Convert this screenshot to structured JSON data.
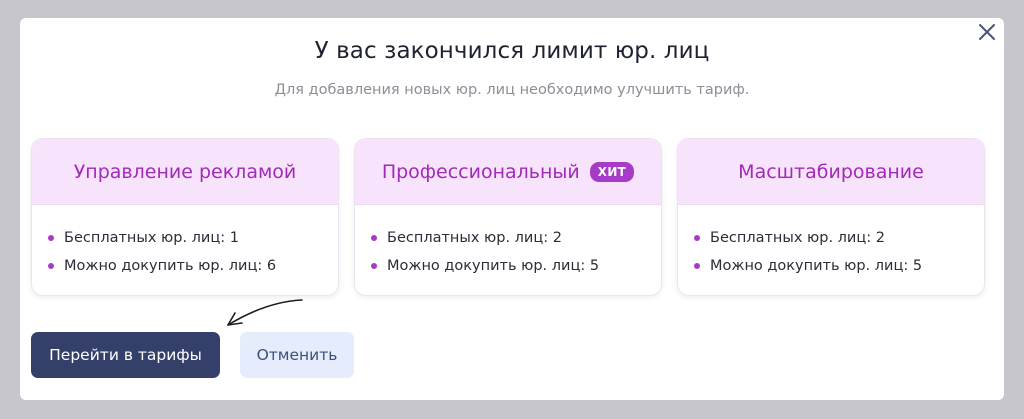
{
  "modal": {
    "title": "У вас закончился лимит юр. лиц",
    "subtitle": "Для добавления новых юр. лиц необходимо улучшить тариф.",
    "close_icon": "close-icon"
  },
  "plans": [
    {
      "name": "Управление рекламой",
      "badge": "",
      "features": [
        "Бесплатных юр. лиц: 1",
        "Можно докупить юр. лиц: 6"
      ]
    },
    {
      "name": "Профессиональный",
      "badge": "ХИТ",
      "features": [
        "Бесплатных юр. лиц: 2",
        "Можно докупить юр. лиц: 5"
      ]
    },
    {
      "name": "Масштабирование",
      "badge": "",
      "features": [
        "Бесплатных юр. лиц: 2",
        "Можно докупить юр. лиц: 5"
      ]
    }
  ],
  "actions": {
    "primary_label": "Перейти в тарифы",
    "secondary_label": "Отменить"
  },
  "colors": {
    "accent": "#a63bc7",
    "card_header_bg": "#f7e3fb",
    "primary_button": "#34406a",
    "secondary_button": "#e5edfc"
  }
}
